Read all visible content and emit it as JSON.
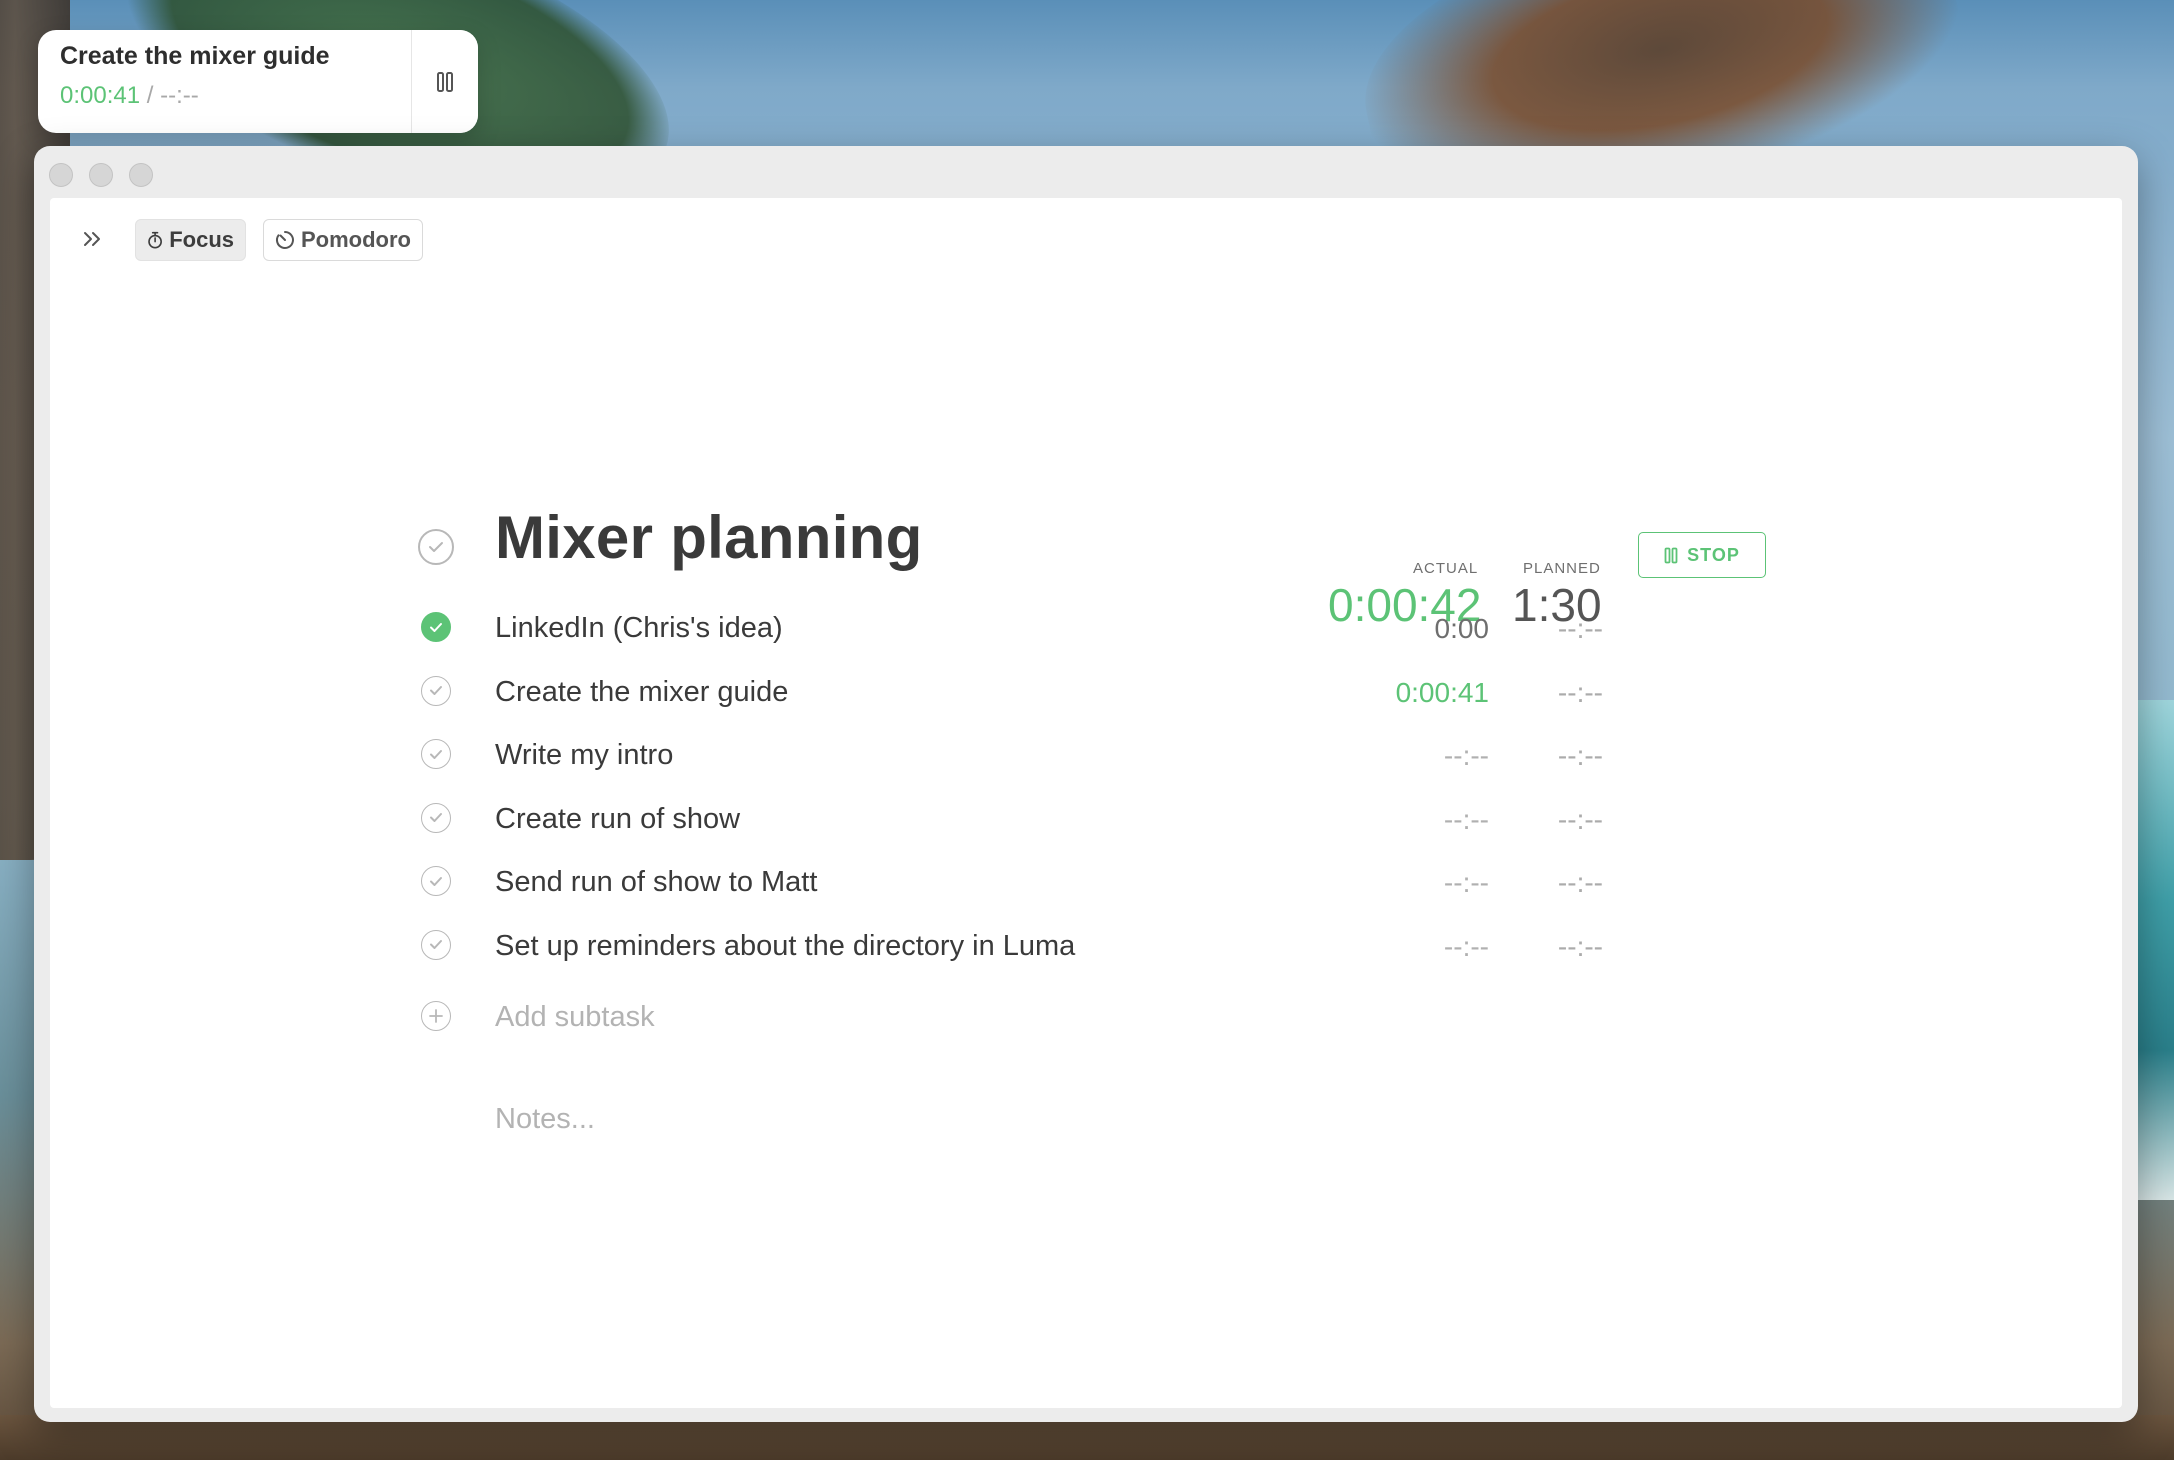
{
  "mini_timer": {
    "task": "Create the mixer guide",
    "actual": "0:00:41",
    "separator": "/",
    "planned": "--:--",
    "pause_icon": "pause-icon"
  },
  "toolbar": {
    "sidebar_toggle_icon": "double-chevron-right-icon",
    "focus_label": "Focus",
    "focus_icon": "stopwatch-icon",
    "pomodoro_label": "Pomodoro",
    "pomodoro_icon": "timer-icon"
  },
  "task": {
    "title": "Mixer planning",
    "actual_header": "ACTUAL",
    "planned_header": "PLANNED",
    "actual_total": "0:00:42",
    "planned_total": "1:30",
    "stop_label": "STOP",
    "subtasks": [
      {
        "label": "LinkedIn (Chris's idea)",
        "actual": "0:00",
        "planned": "--:--",
        "done": true
      },
      {
        "label": "Create the mixer guide",
        "actual": "0:00:41",
        "planned": "--:--",
        "done": false
      },
      {
        "label": "Write my intro",
        "actual": "--:--",
        "planned": "--:--",
        "done": false
      },
      {
        "label": "Create run of show",
        "actual": "--:--",
        "planned": "--:--",
        "done": false
      },
      {
        "label": "Send run of show to Matt",
        "actual": "--:--",
        "planned": "--:--",
        "done": false
      },
      {
        "label": "Set up reminders about the directory in Luma",
        "actual": "--:--",
        "planned": "--:--",
        "done": false
      }
    ],
    "add_subtask_placeholder": "Add subtask",
    "notes_placeholder": "Notes..."
  },
  "colors": {
    "accent_green": "#5cc376",
    "text_dark": "#3a3a3a",
    "muted": "#b0b0b0"
  }
}
